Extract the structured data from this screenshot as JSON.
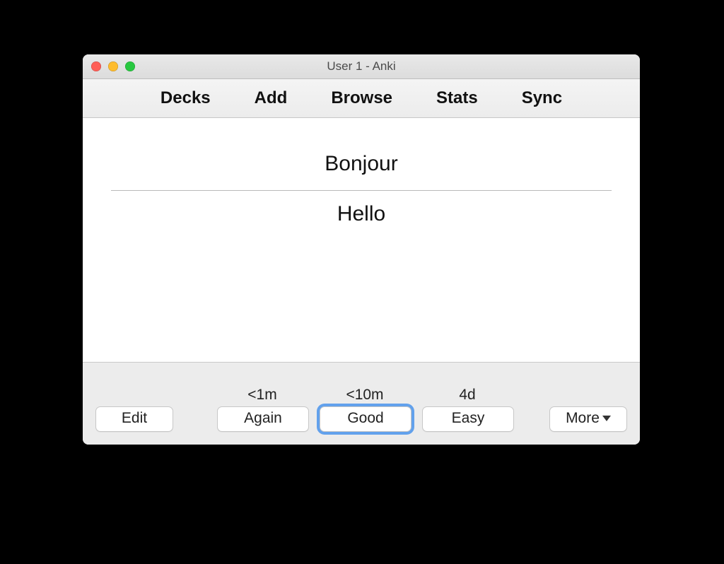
{
  "window": {
    "title": "User 1 - Anki"
  },
  "nav": {
    "decks": "Decks",
    "add": "Add",
    "browse": "Browse",
    "stats": "Stats",
    "sync": "Sync"
  },
  "card": {
    "front": "Bonjour",
    "back": "Hello"
  },
  "review": {
    "again": {
      "label": "Again",
      "interval": "<1m"
    },
    "good": {
      "label": "Good",
      "interval": "<10m"
    },
    "easy": {
      "label": "Easy",
      "interval": "4d"
    }
  },
  "actions": {
    "edit": "Edit",
    "more": "More"
  }
}
